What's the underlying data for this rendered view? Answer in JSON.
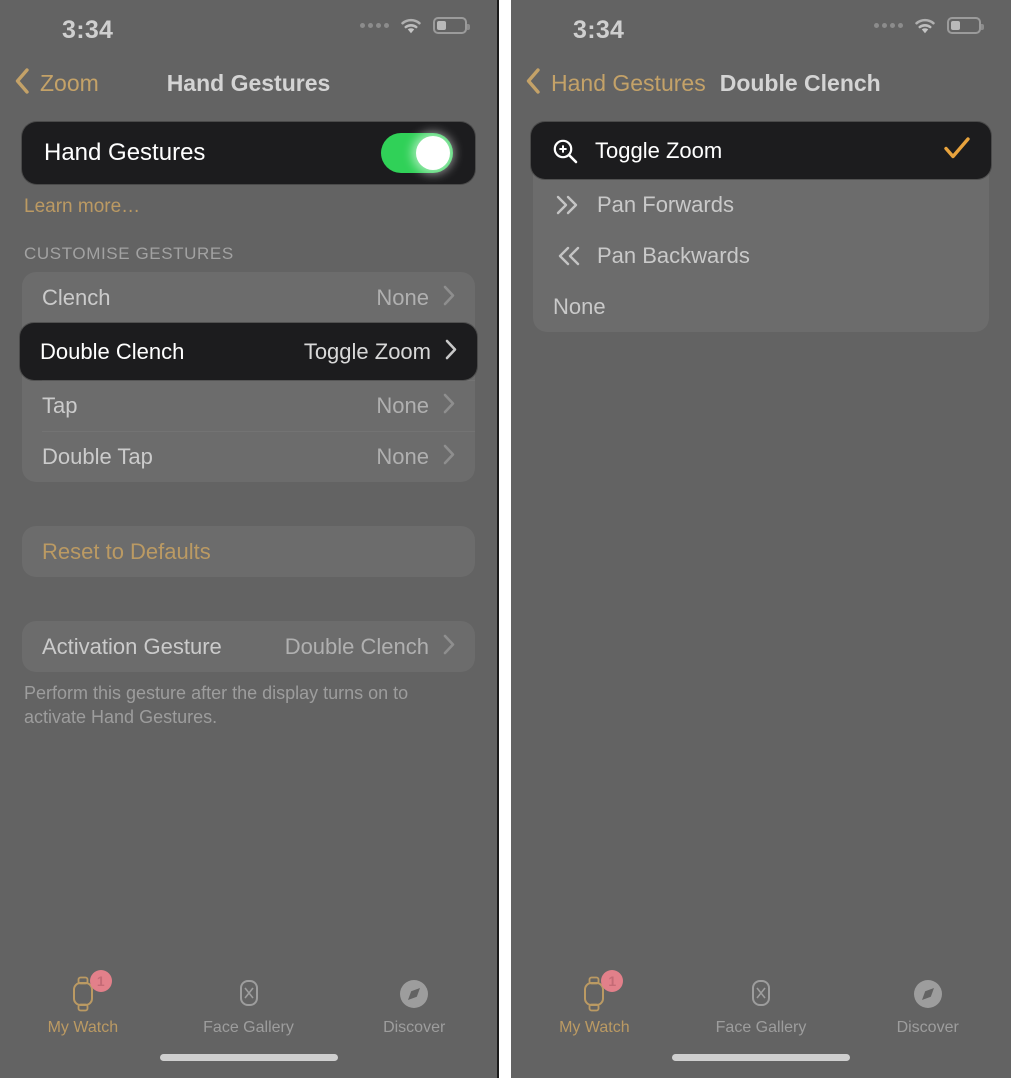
{
  "status_bar": {
    "time": "3:34",
    "icons": [
      "signal-dots-icon",
      "wifi-icon",
      "battery-icon"
    ],
    "battery_level_percent": 36
  },
  "colors": {
    "screen_background": "#636363",
    "highlight_card": "#1c1c1e",
    "accent_tan": "#c4a268",
    "accent_orange": "#e8a33d",
    "toggle_on_green": "#30d158",
    "badge_red": "#e2808a"
  },
  "left_panel": {
    "nav": {
      "back_label": "Zoom",
      "title": "Hand Gestures"
    },
    "master_toggle": {
      "label": "Hand Gestures",
      "state": "on"
    },
    "learn_more": "Learn more…",
    "section_header": "CUSTOMISE GESTURES",
    "gesture_rows": [
      {
        "label": "Clench",
        "value": "None",
        "highlighted": false
      },
      {
        "label": "Double Clench",
        "value": "Toggle Zoom",
        "highlighted": true
      },
      {
        "label": "Tap",
        "value": "None",
        "highlighted": false
      },
      {
        "label": "Double Tap",
        "value": "None",
        "highlighted": false
      }
    ],
    "reset_action": "Reset to Defaults",
    "activation_row": {
      "label": "Activation Gesture",
      "value": "Double Clench"
    },
    "activation_footnote": "Perform this gesture after the display turns on to activate Hand Gestures."
  },
  "right_panel": {
    "nav": {
      "back_label": "Hand Gestures",
      "title": "Double Clench"
    },
    "options": [
      {
        "label": "Toggle Zoom",
        "icon": "magnifier-plus-icon",
        "selected": true,
        "highlighted": true
      },
      {
        "label": "Pan Forwards",
        "icon": "chevron-double-right-icon",
        "selected": false,
        "highlighted": false
      },
      {
        "label": "Pan Backwards",
        "icon": "chevron-double-left-icon",
        "selected": false,
        "highlighted": false
      },
      {
        "label": "None",
        "icon": "",
        "selected": false,
        "highlighted": false
      }
    ]
  },
  "tab_bar": {
    "tabs": [
      {
        "label": "My Watch",
        "icon": "watch-icon",
        "badge": "1",
        "active": true
      },
      {
        "label": "Face Gallery",
        "icon": "watchface-icon",
        "badge": "",
        "active": false
      },
      {
        "label": "Discover",
        "icon": "compass-icon",
        "badge": "",
        "active": false
      }
    ]
  }
}
